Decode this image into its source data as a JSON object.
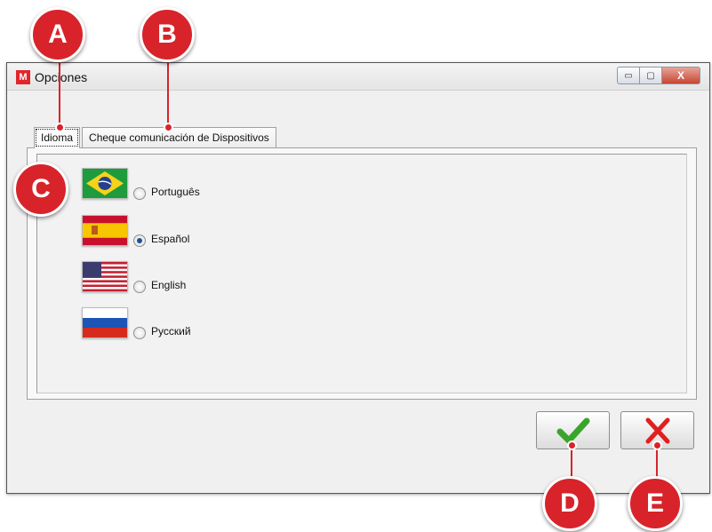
{
  "window": {
    "title": "Opciones",
    "app_icon_letter": "M",
    "controls": {
      "minimize": "▭",
      "maximize": "▢",
      "close": "X"
    }
  },
  "tabs": [
    {
      "label": "Idioma",
      "active": true
    },
    {
      "label": "Cheque comunicación de Dispositivos",
      "active": false
    }
  ],
  "languages": [
    {
      "label": "Português",
      "flag": "brazil-flag-icon",
      "selected": false
    },
    {
      "label": "Español",
      "flag": "spain-flag-icon",
      "selected": true
    },
    {
      "label": "English",
      "flag": "usa-flag-icon",
      "selected": false
    },
    {
      "label": "Русский",
      "flag": "russia-flag-icon",
      "selected": false
    }
  ],
  "buttons": {
    "ok": "check-icon",
    "cancel": "x-icon"
  },
  "callouts": {
    "a": "A",
    "b": "B",
    "c": "C",
    "d": "D",
    "e": "E"
  },
  "colors": {
    "callout": "#d8232a",
    "check": "#3aa52b",
    "cancel": "#e02020"
  }
}
